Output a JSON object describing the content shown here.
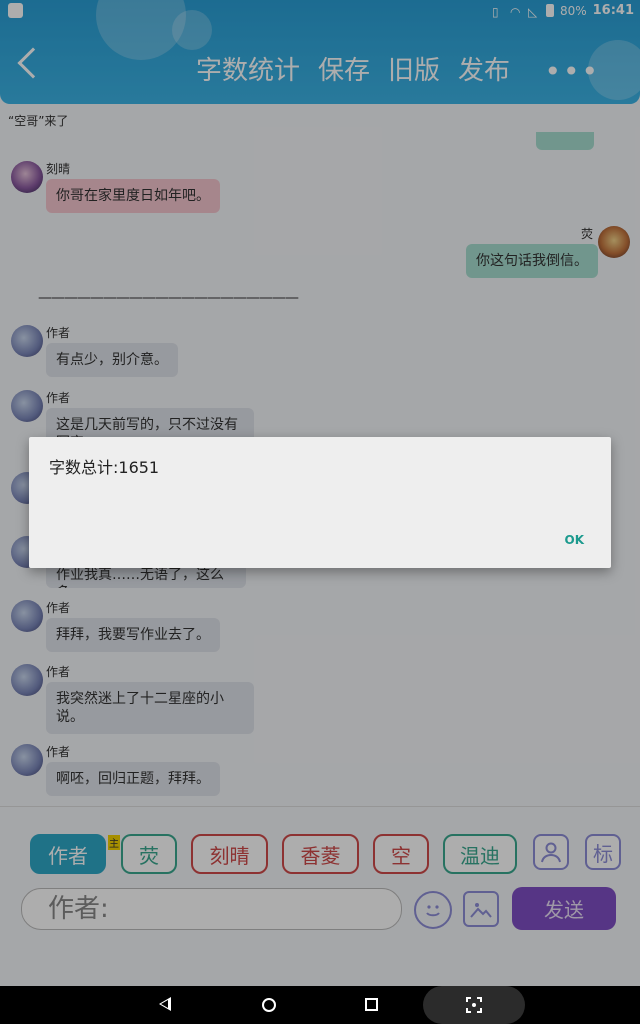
{
  "status_bar": {
    "battery": "80%",
    "time": "16:41"
  },
  "header": {
    "menu": [
      "字数统计",
      "保存",
      "旧版",
      "发布"
    ],
    "more": "•••"
  },
  "subtitle": "“空哥”来了",
  "chat": {
    "messages": [
      {
        "sender": "刻晴",
        "text": "你哥在家里度日如年吧。"
      },
      {
        "sender": "荧",
        "text": "你这句话我倒信。"
      },
      {
        "divider": "————————————————————"
      },
      {
        "sender": "作者",
        "text": "有点少，别介意。"
      },
      {
        "sender": "作者",
        "text": "这是几天前写的，只不过没有写完"
      },
      {
        "sender": "作者",
        "text": "作业我真……无语了，这么多。"
      },
      {
        "sender": "作者",
        "text": "拜拜，我要写作业去了。"
      },
      {
        "sender": "作者",
        "text": "我突然迷上了十二星座的小说。"
      },
      {
        "sender": "作者",
        "text": "啊呸，回归正题，拜拜。"
      }
    ]
  },
  "dialog": {
    "message": "字数总计:1651",
    "ok_label": "OK"
  },
  "toolbar": {
    "characters": [
      {
        "label": "作者",
        "color": "#2fa8c8",
        "active": true
      },
      {
        "label": "荧",
        "color": "#3aa88f",
        "active": false
      },
      {
        "label": "刻晴",
        "color": "#d04a4a",
        "active": false
      },
      {
        "label": "香菱",
        "color": "#d04a4a",
        "active": false
      },
      {
        "label": "空",
        "color": "#d04a4a",
        "active": false
      },
      {
        "label": "温迪",
        "color": "#3aa88f",
        "active": false
      }
    ],
    "host_badge": "主",
    "person_icon": "person-icon",
    "tag_label": "标",
    "input_placeholder": "作者:",
    "send_label": "发送"
  },
  "colors": {
    "accent": "#2fa8c8",
    "send": "#7f4ec4",
    "icon": "#8e8ed8"
  }
}
